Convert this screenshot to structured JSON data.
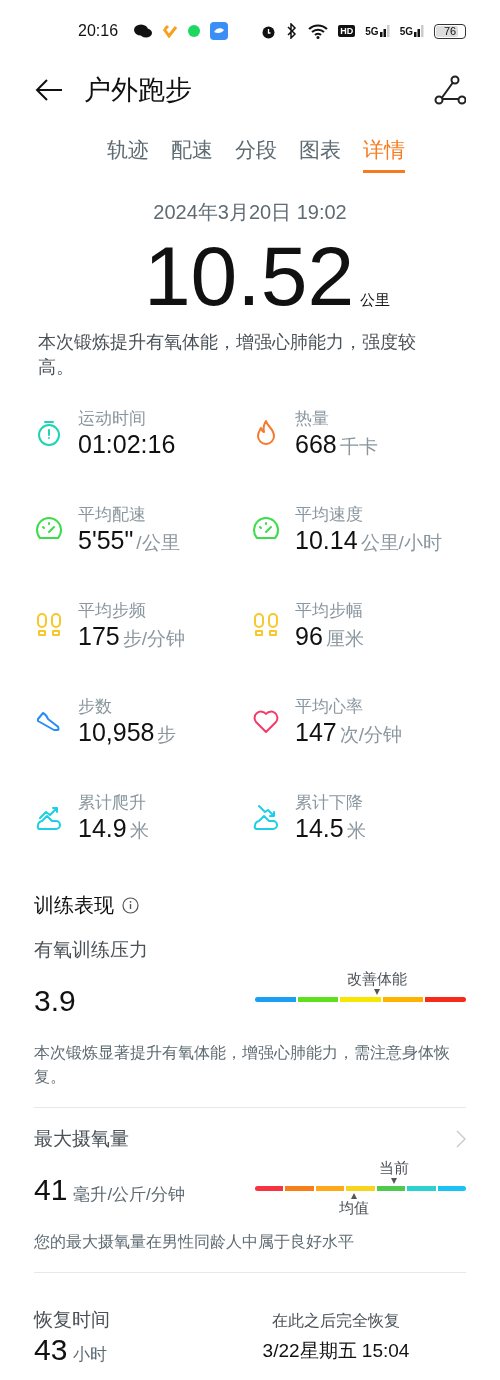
{
  "status_bar": {
    "time": "20:16",
    "hd": "HD",
    "networks": [
      "5G",
      "5G"
    ],
    "battery": "76"
  },
  "header": {
    "title": "户外跑步"
  },
  "tabs": [
    {
      "label": "轨迹",
      "selected": false
    },
    {
      "label": "配速",
      "selected": false
    },
    {
      "label": "分段",
      "selected": false
    },
    {
      "label": "图表",
      "selected": false
    },
    {
      "label": "详情",
      "selected": true
    }
  ],
  "date": "2024年3月20日 19:02",
  "distance": {
    "value": "10.52",
    "unit": "公里"
  },
  "summary": "本次锻炼提升有氧体能，增强心肺能力，强度较高。",
  "stats": [
    {
      "kind": "timer",
      "color": "#1ed4b4",
      "label": "运动时间",
      "value": "01:02:16"
    },
    {
      "kind": "flame",
      "color": "#f57a30",
      "label": "热量",
      "value": "668",
      "unit": "千卡"
    },
    {
      "kind": "gauge",
      "color": "#3ddc4a",
      "label": "平均配速",
      "value": "5'55\"",
      "unit": "/公里"
    },
    {
      "kind": "gauge",
      "color": "#3ddc4a",
      "label": "平均速度",
      "value": "10.14",
      "unit": "公里/小时"
    },
    {
      "kind": "feet",
      "color": "#f7c82a",
      "label": "平均步频",
      "value": "175",
      "unit": "步/分钟"
    },
    {
      "kind": "feet",
      "color": "#f7c82a",
      "label": "平均步幅",
      "value": "96",
      "unit": "厘米"
    },
    {
      "kind": "shoe",
      "color": "#2a8cf5",
      "label": "步数",
      "value": "10,958",
      "unit": "步"
    },
    {
      "kind": "heart",
      "color": "#f53a6a",
      "label": "平均心率",
      "value": "147",
      "unit": "次/分钟"
    },
    {
      "kind": "climb",
      "color": "#1ccfe6",
      "label": "累计爬升",
      "value": "14.9",
      "unit": "米"
    },
    {
      "kind": "descend",
      "color": "#1ccfe6",
      "label": "累计下降",
      "value": "14.5",
      "unit": "米"
    }
  ],
  "performance": {
    "title": "训练表现",
    "aerobic": {
      "title": "有氧训练压力",
      "value": "3.9",
      "marker_label": "改善体能",
      "note": "本次锻炼显著提升有氧体能，增强心肺能力，需注意身体恢复。"
    },
    "vo2max": {
      "title": "最大摄氧量",
      "value": "41",
      "unit": "毫升/公斤/分钟",
      "current_label": "当前",
      "average_label": "均值",
      "note": "您的最大摄氧量在男性同龄人中属于良好水平"
    },
    "recovery": {
      "title": "恢复时间",
      "value": "43",
      "unit": "小时",
      "until_label": "在此之后完全恢复",
      "until": "3/22星期五 15:04"
    }
  }
}
